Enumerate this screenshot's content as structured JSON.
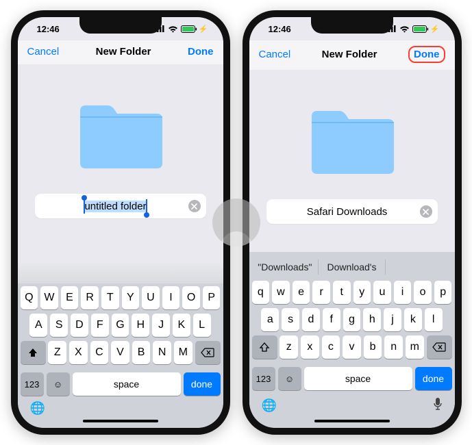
{
  "status": {
    "time": "12:46"
  },
  "colors": {
    "accent": "#007aff",
    "ring": "#ff3b30"
  },
  "left": {
    "nav": {
      "cancel": "Cancel",
      "title": "New Folder",
      "done": "Done"
    },
    "folder_name": "untitled folder",
    "selection_active": true,
    "keyboard_case": "upper",
    "suggestions": [],
    "space_label": "space",
    "return_label": "done",
    "numkey_label": "123"
  },
  "right": {
    "nav": {
      "cancel": "Cancel",
      "title": "New Folder",
      "done": "Done"
    },
    "folder_name": "Safari Downloads",
    "selection_active": false,
    "keyboard_case": "lower",
    "suggestions": [
      "\"Downloads\"",
      "Download's",
      ""
    ],
    "space_label": "space",
    "return_label": "done",
    "numkey_label": "123"
  },
  "keys_row1": [
    "Q",
    "W",
    "E",
    "R",
    "T",
    "Y",
    "U",
    "I",
    "O",
    "P"
  ],
  "keys_row2": [
    "A",
    "S",
    "D",
    "F",
    "G",
    "H",
    "J",
    "K",
    "L"
  ],
  "keys_row3": [
    "Z",
    "X",
    "C",
    "V",
    "B",
    "N",
    "M"
  ],
  "keys_row1_l": [
    "q",
    "w",
    "e",
    "r",
    "t",
    "y",
    "u",
    "i",
    "o",
    "p"
  ],
  "keys_row2_l": [
    "a",
    "s",
    "d",
    "f",
    "g",
    "h",
    "j",
    "k",
    "l"
  ],
  "keys_row3_l": [
    "z",
    "x",
    "c",
    "v",
    "b",
    "n",
    "m"
  ]
}
